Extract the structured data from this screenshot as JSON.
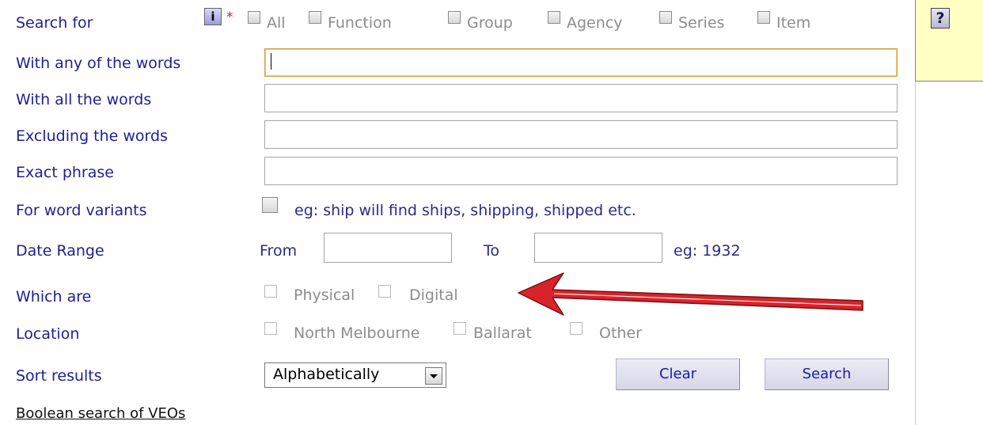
{
  "form": {
    "search_for": {
      "label": "Search for",
      "info_icon": "info-icon",
      "required_marker": "*",
      "options": [
        "All",
        "Function",
        "Group",
        "Agency",
        "Series",
        "Item"
      ]
    },
    "any_words": {
      "label": "With any of the words",
      "value": ""
    },
    "all_words": {
      "label": "With all the words",
      "value": ""
    },
    "excluding": {
      "label": "Excluding the words",
      "value": ""
    },
    "exact": {
      "label": "Exact phrase",
      "value": ""
    },
    "variants": {
      "label": "For word variants",
      "hint": "eg: ship will find ships, shipping, shipped etc."
    },
    "date_range": {
      "label": "Date Range",
      "from_label": "From",
      "to_label": "To",
      "from_value": "",
      "to_value": "",
      "hint": "eg: 1932"
    },
    "which_are": {
      "label": "Which are",
      "options": [
        "Physical",
        "Digital"
      ]
    },
    "location": {
      "label": "Location",
      "options": [
        "North Melbourne",
        "Ballarat",
        "Other"
      ]
    },
    "sort": {
      "label": "Sort results",
      "selected": "Alphabetically"
    },
    "buttons": {
      "clear": "Clear",
      "search": "Search"
    },
    "boolean_link": "Boolean search of VEOs"
  },
  "help": {
    "button_label": "?"
  },
  "annotation": {
    "arrow_color": "#d8232a"
  },
  "colors": {
    "label": "#1f1f8f",
    "help_bg": "#ffffc4",
    "button_bg": "#dcdcec"
  }
}
